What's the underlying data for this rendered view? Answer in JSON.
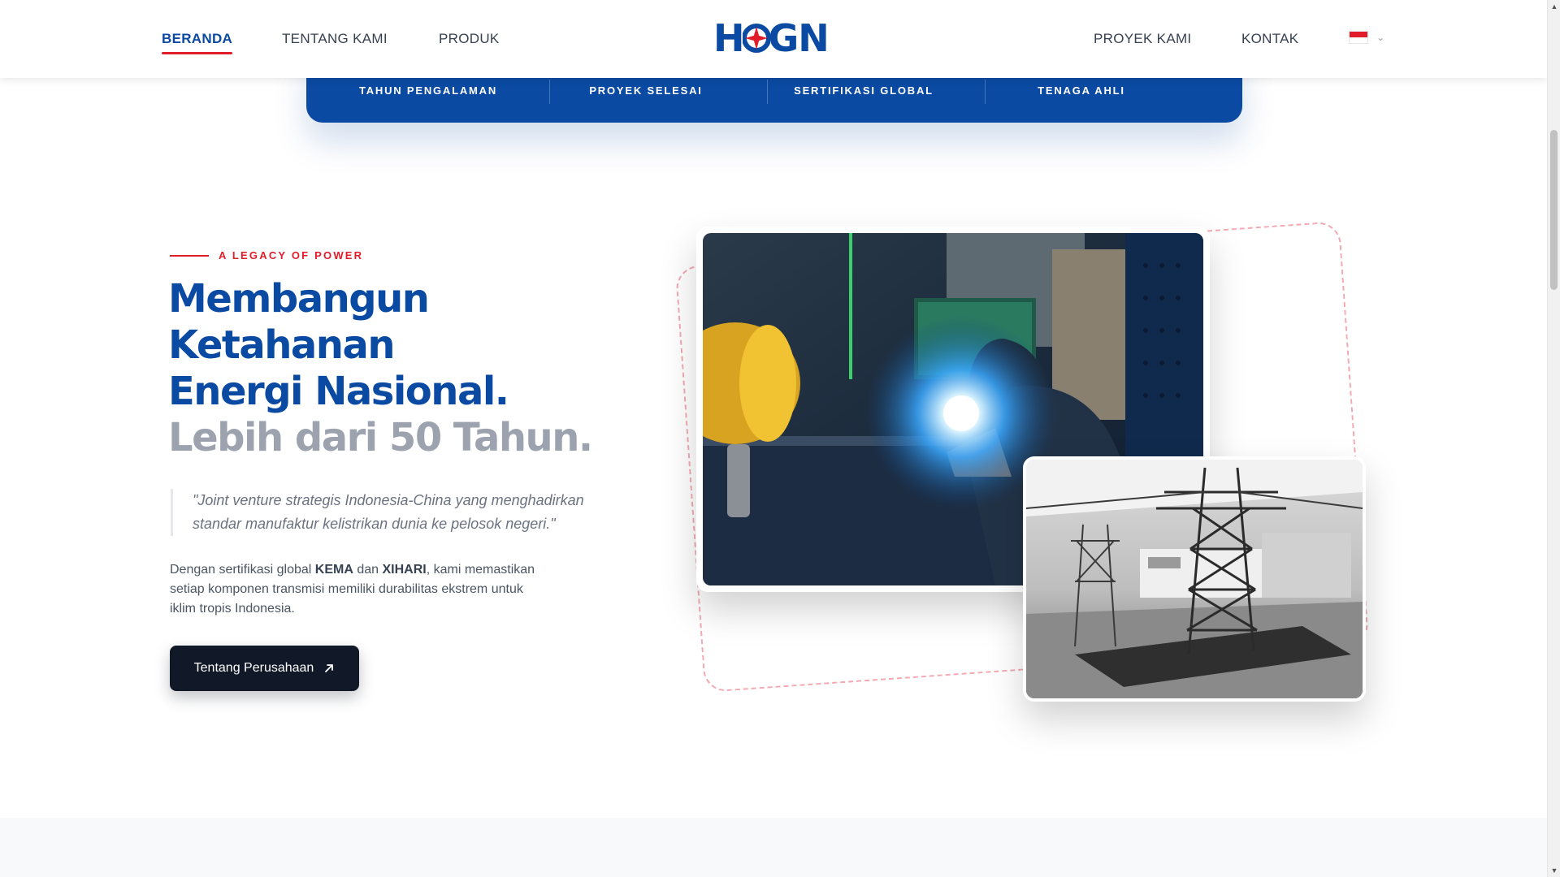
{
  "nav": {
    "left": [
      {
        "label": "BERANDA",
        "active": true
      },
      {
        "label": "TENTANG KAMI",
        "active": false
      },
      {
        "label": "PRODUK",
        "active": false
      }
    ],
    "right": [
      {
        "label": "PROYEK KAMI"
      },
      {
        "label": "KONTAK"
      }
    ],
    "logo_text": {
      "left": "H",
      "right": "GN"
    },
    "language": {
      "flag_icon": "indonesia-flag-icon",
      "dropdown_icon": "chevron-down-icon"
    }
  },
  "stats": {
    "items": [
      {
        "label": "TAHUN PENGALAMAN"
      },
      {
        "label": "PROYEK SELESAI"
      },
      {
        "label": "SERTIFIKASI GLOBAL"
      },
      {
        "label": "TENAGA AHLI"
      }
    ]
  },
  "hero": {
    "eyebrow": "A LEGACY OF POWER",
    "headline": {
      "line1": "Membangun",
      "line2": "Ketahanan",
      "line3": "Energi Nasional.",
      "line4": "Lebih dari 50 Tahun."
    },
    "quote": "\"Joint venture strategis Indonesia-China yang menghadirkan standar manufaktur kelistrikan dunia ke pelosok negeri.\"",
    "description": {
      "part1": "Dengan sertifikasi global ",
      "kema": "KEMA",
      "part2": " dan ",
      "xihari": "XIHARI",
      "part3": ", kami memastikan setiap komponen transmisi memiliki durabilitas ekstrem untuk iklim tropis Indonesia."
    },
    "cta_label": "Tentang Perusahaan",
    "cta_icon": "arrow-up-right-icon"
  },
  "images": {
    "main": "welding-photo",
    "secondary": "transmission-tower-model-photo"
  },
  "colors": {
    "brand_blue": "#0b4aa2",
    "accent_red": "#e11d2a",
    "dark_button": "#111827",
    "muted_gray": "#9ca3af"
  }
}
